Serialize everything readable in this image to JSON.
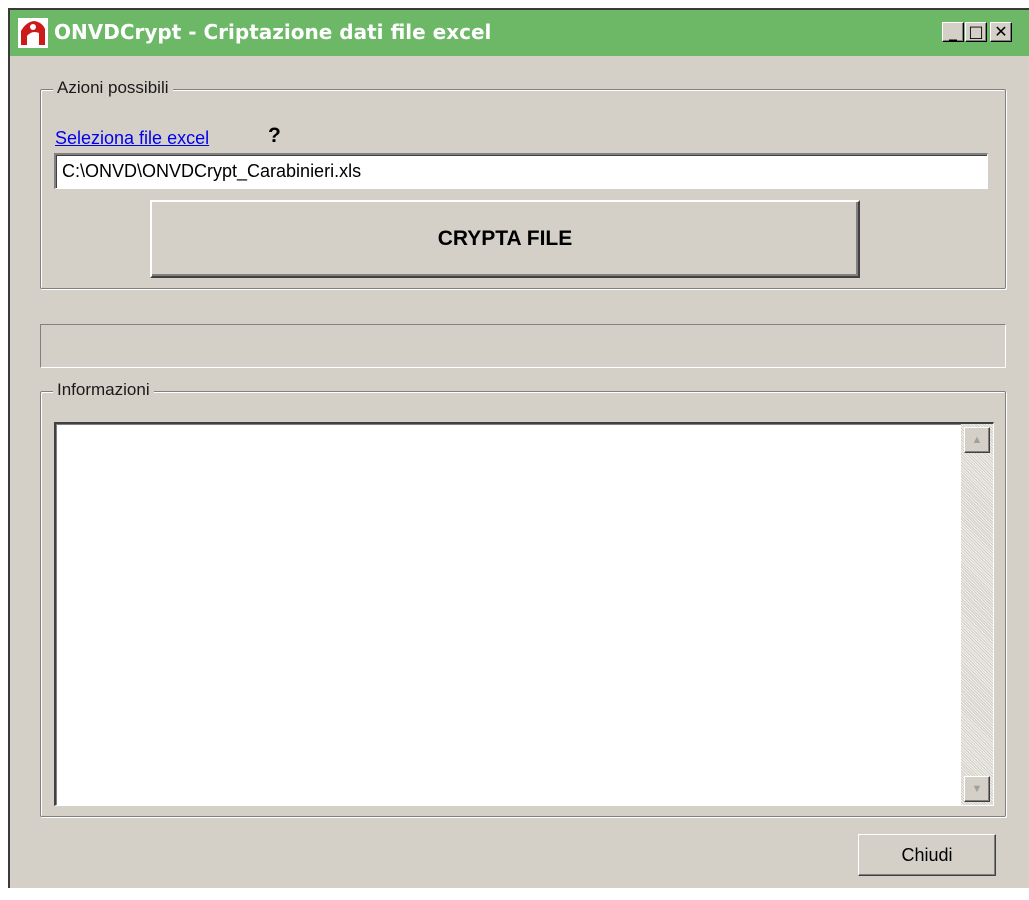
{
  "window": {
    "title": "ONVDCrypt - Criptazione dati file excel",
    "controls": {
      "minimize": "_",
      "maximize": "□",
      "close": "✕"
    }
  },
  "actions_group": {
    "legend": "Azioni possibili",
    "select_link": "Seleziona file excel",
    "help_label": "?",
    "file_path": "C:\\ONVD\\ONVDCrypt_Carabinieri.xls",
    "crypt_button": "CRYPTA FILE"
  },
  "progress": {
    "value": 0
  },
  "info_group": {
    "legend": "Informazioni",
    "content": "",
    "scroll_up": "▲",
    "scroll_down": "▼"
  },
  "footer": {
    "close_button": "Chiudi"
  },
  "colors": {
    "titlebar": "#6cb866",
    "face": "#d4d0c8",
    "link": "#0000ee"
  }
}
